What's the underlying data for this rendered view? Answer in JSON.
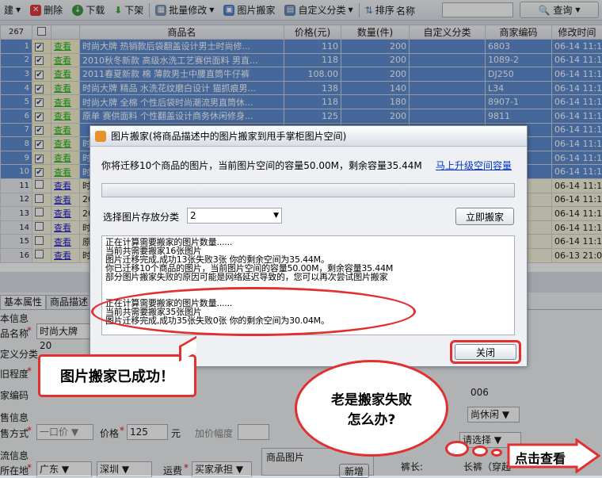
{
  "toolbar": {
    "items": [
      "建",
      "删除",
      "下载",
      "下架",
      "批量修改",
      "图片搬家",
      "自定义分类",
      "排序"
    ],
    "name_label": "名称",
    "search_label": "查询"
  },
  "table": {
    "headers": [
      "267",
      "",
      "",
      "商品名",
      "价格(元)",
      "数量(件)",
      "自定义分类",
      "商家编码",
      "修改时间"
    ],
    "rows": [
      {
        "idx": "1",
        "link": "查看",
        "name": "时尚大牌 热销款后袋翻盖设计男士时尚修...",
        "price": "110",
        "qty": "200",
        "cat": "",
        "code": "6803",
        "time": "06-14 11:17",
        "sel": true
      },
      {
        "idx": "2",
        "link": "查看",
        "name": "2010秋冬新款 高级水洗工艺赛供面料 男直...",
        "price": "118",
        "qty": "200",
        "cat": "",
        "code": "1089-2",
        "time": "06-14 11:17",
        "sel": true
      },
      {
        "idx": "3",
        "link": "查看",
        "name": "2011春夏新款 棉 薄款男士中腰直筒牛仔裤",
        "price": "108.00",
        "qty": "200",
        "cat": "",
        "code": "DJ250",
        "time": "06-14 11:17",
        "sel": true
      },
      {
        "idx": "4",
        "link": "查看",
        "name": "时尚大牌 精品 水洗花纹磨白设计 猫抓痕男...",
        "price": "138",
        "qty": "140",
        "cat": "",
        "code": "L34",
        "time": "06-14 11:17",
        "sel": true
      },
      {
        "idx": "5",
        "link": "查看",
        "name": "时尚大牌 全棉 个性后袋时尚潮流男直筒休...",
        "price": "118",
        "qty": "180",
        "cat": "",
        "code": "8907-1",
        "time": "06-14 11:17",
        "sel": true
      },
      {
        "idx": "6",
        "link": "查看",
        "name": "原单 赛供面料 个性翻盖设计商务休闲修身...",
        "price": "125",
        "qty": "200",
        "cat": "",
        "code": "9811",
        "time": "06-14 11:17",
        "sel": true
      },
      {
        "idx": "7",
        "link": "查看",
        "name": "",
        "price": "",
        "qty": "",
        "cat": "",
        "code": "",
        "time": "06-14 11:17",
        "sel": true
      },
      {
        "idx": "8",
        "link": "查看",
        "name": "时",
        "price": "",
        "qty": "",
        "cat": "",
        "code": "",
        "time": "06-14 11:16",
        "sel": true
      },
      {
        "idx": "9",
        "link": "查看",
        "name": "时",
        "price": "",
        "qty": "",
        "cat": "",
        "code": "",
        "time": "06-14 11:16",
        "sel": true
      },
      {
        "idx": "10",
        "link": "查看",
        "name": "时",
        "price": "",
        "qty": "",
        "cat": "",
        "code": "",
        "time": "06-14 11:16",
        "sel": true
      },
      {
        "idx": "11",
        "link": "查看",
        "name": "时",
        "price": "",
        "qty": "",
        "cat": "",
        "code": "",
        "time": "06-14 11:16",
        "sel": false
      },
      {
        "idx": "12",
        "link": "查看",
        "name": "20",
        "price": "",
        "qty": "",
        "cat": "",
        "code": "",
        "time": "06-14 11:16",
        "sel": false
      },
      {
        "idx": "13",
        "link": "查看",
        "name": "20",
        "price": "",
        "qty": "",
        "cat": "",
        "code": "",
        "time": "06-14 11:16",
        "sel": false
      },
      {
        "idx": "14",
        "link": "查看",
        "name": "时",
        "price": "",
        "qty": "",
        "cat": "",
        "code": "",
        "time": "06-14 11:16",
        "sel": false
      },
      {
        "idx": "15",
        "link": "查看",
        "name": "原",
        "price": "",
        "qty": "",
        "cat": "",
        "code": "",
        "time": "06-14 11:16",
        "sel": false
      },
      {
        "idx": "16",
        "link": "查看",
        "name": "时",
        "price": "",
        "qty": "",
        "cat": "",
        "code": "",
        "time": "06-13 21:03",
        "sel": false
      }
    ]
  },
  "form": {
    "tabs": [
      "基本属性",
      "商品描述"
    ],
    "basic_info": "本信息",
    "product_name_label": "品名称",
    "product_name_value": "时尚大牌 20",
    "custom_cat_label": "定义分类",
    "degree_label": "旧程度",
    "merchant_code_label": "家编码",
    "code_partial": "006",
    "sale_info": "售信息",
    "sale_method_label": "售方式",
    "sale_method_value": "一口价",
    "price_label": "价格",
    "price_value": "125",
    "yuan": "元",
    "markup_label": "加价幅度",
    "logistics": "流信息",
    "location_label": "所在地",
    "province": "广东",
    "city": "深圳",
    "shipping_label": "运费",
    "shipping_value": "买家承担",
    "product_image_label": "商品图片",
    "new_button": "新增",
    "style_value": "尚休闲",
    "select_value": "请选择",
    "trousers_label": "裤长:",
    "trousers_value": "长裤（穿起"
  },
  "dialog": {
    "title": "图片搬家(将商品描述中的图片搬家到甩手掌柜图片空间)",
    "info": "你将迁移10个商品的图片，当前图片空间的容量50.00M，剩余容量35.44M",
    "upgrade_link": "马上升级空间容量",
    "category_label": "选择图片存放分类",
    "category_value": "2",
    "start_button": "立即搬家",
    "close_button": "关闭",
    "log": [
      "正在计算需要搬家的图片数量......",
      "当前共需要搬家16张图片",
      "图片迁移完成,成功13张失败3张 你的剩余空间为35.44M。",
      "你已迁移10个商品的图片，当前图片空间的容量50.00M，剩余容量35.44M",
      "部分图片搬家失败的原因可能是网络延迟导致的，您可以再次尝试图片搬家",
      "",
      "",
      "正在计算需要搬家的图片数量......",
      "当前共需要搬家35张图片",
      "图片迁移完成,成功35张失败0张 你的剩余空间为30.04M。"
    ]
  },
  "callouts": {
    "success": "图片搬家已成功！",
    "fail_line1": "老是搬家失败",
    "fail_line2": "怎么办?",
    "check": "点击查看"
  },
  "colors": {
    "accent_red": "#e03030",
    "selected_row": "#4a7fcc",
    "link": "#0033cc"
  }
}
